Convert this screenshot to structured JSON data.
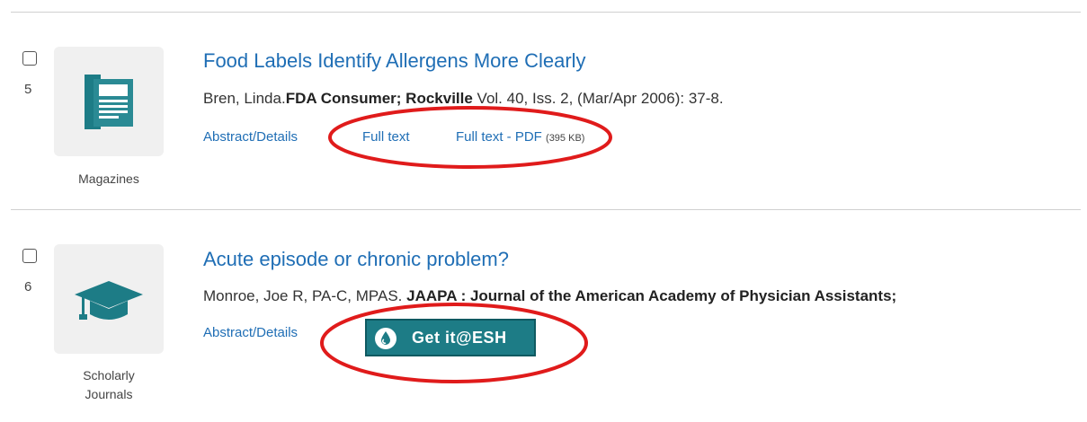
{
  "results": [
    {
      "number": "5",
      "type": "Magazines",
      "title": "Food Labels Identify Allergens More Clearly",
      "author": "Bren, Linda.",
      "publication": "FDA Consumer; Rockville",
      "details": " Vol. 40, Iss. 2,  (Mar/Apr 2006): 37-8.",
      "links": {
        "abstract": "Abstract/Details",
        "full_text": "Full text",
        "full_text_pdf": "Full text - PDF",
        "pdf_size": "(395 KB)"
      }
    },
    {
      "number": "6",
      "type_line1": "Scholarly",
      "type_line2": "Journals",
      "title": "Acute episode or chronic problem?",
      "author": "Monroe, Joe R, PA-C, MPAS.",
      "publication": "JAAPA : Journal of the American Academy of Physician Assistants;",
      "links": {
        "abstract": "Abstract/Details",
        "getit": "Get it@ESH"
      }
    }
  ],
  "colors": {
    "link": "#1f6eb5",
    "icon_teal": "#1d7c86",
    "annotation_red": "#e01b1b"
  }
}
